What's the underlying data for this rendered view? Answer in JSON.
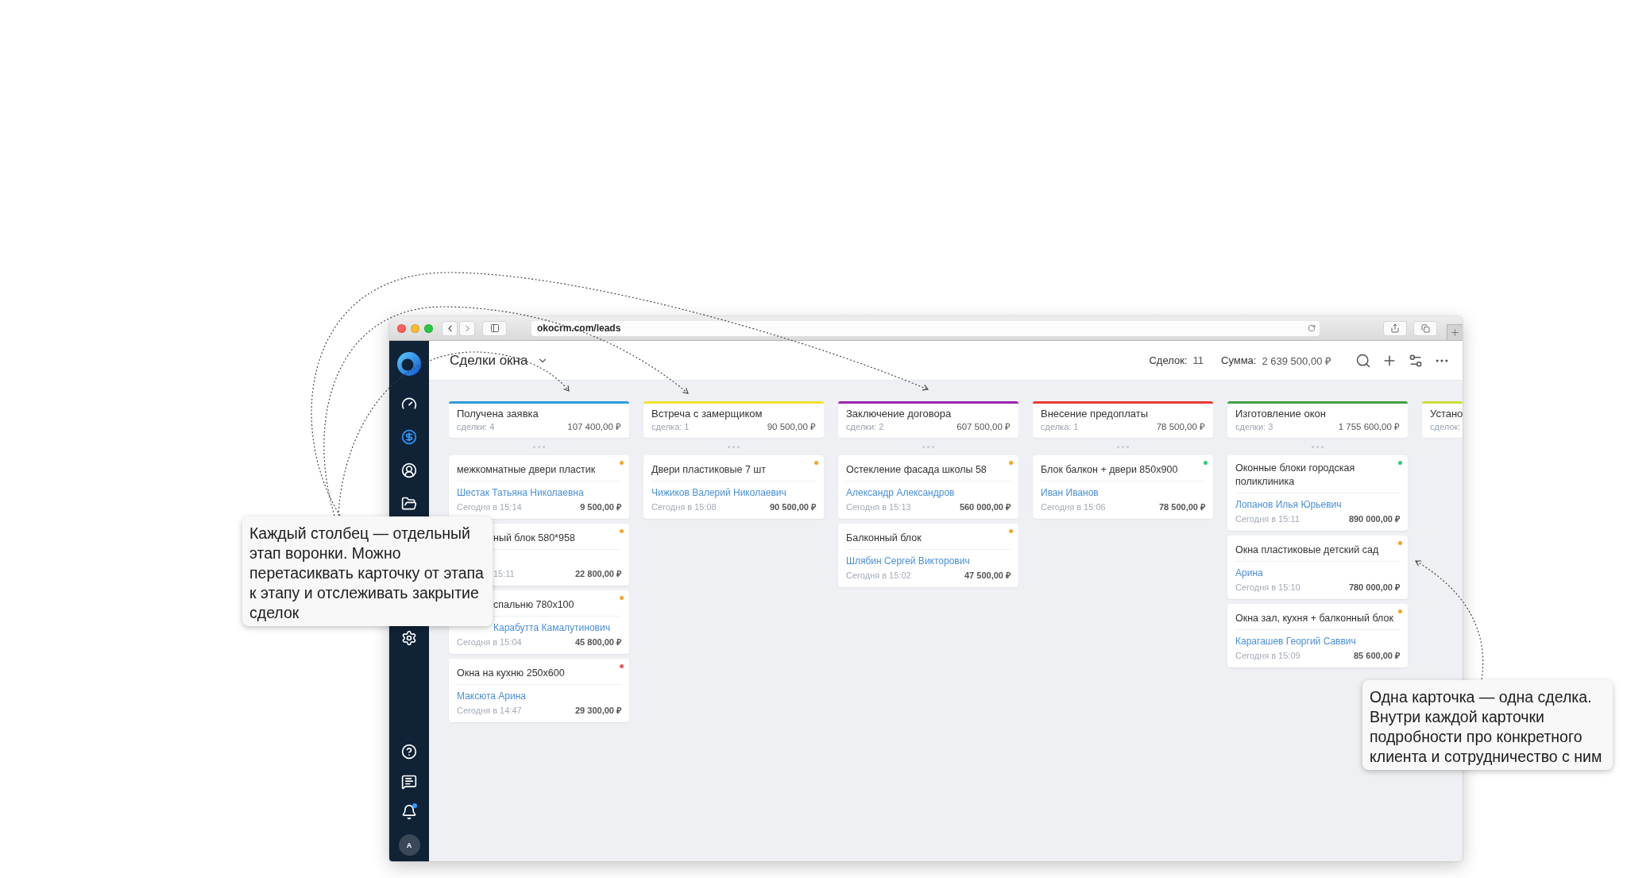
{
  "browser": {
    "url": "okocrm.com/leads"
  },
  "sidebar": {
    "top_items": [
      {
        "kind": "gauge",
        "selected": false
      },
      {
        "kind": "dollar",
        "selected": true
      },
      {
        "kind": "user",
        "selected": false
      },
      {
        "kind": "folder",
        "selected": false
      }
    ],
    "lower_items": [
      {
        "kind": "gear",
        "selected": false
      }
    ],
    "bottom_items": [
      {
        "kind": "help",
        "unread": false
      },
      {
        "kind": "chat",
        "unread": false
      },
      {
        "kind": "bell",
        "unread": true
      }
    ],
    "avatar": "A"
  },
  "header": {
    "title": "Сделки окна",
    "deals_label": "Сделок:",
    "deals_count": "11",
    "sum_label": "Сумма:",
    "sum_value": "2 639 500,00 ₽"
  },
  "board": {
    "columns": [
      {
        "title": "Получена заявка",
        "count": "сделки: 4",
        "amount": "107 400,00 ₽",
        "color": "#2d9cdb",
        "cards": [
          {
            "kind": "deal",
            "title": "межкомнатные двери пластик",
            "client": "Шестак Татьяна Николаевна",
            "date": "Сегодня в 15:14",
            "sum": "9 500,00 ₽",
            "color": "#f5a623"
          },
          {
            "kind": "covered",
            "title": "ный блок 580*958",
            "date": "15:11",
            "sum": "22 800,00 ₽",
            "color": "#f5a623"
          },
          {
            "kind": "partly_covered",
            "title": "спальню 780x100",
            "client": "Карабутта Камалутинович",
            "date": "Сегодня в 15:04",
            "sum": "45 800,00 ₽",
            "color": "#f5a623"
          },
          {
            "kind": "deal",
            "title": "Окна на кухню 250x600",
            "client": "Максюта Арина",
            "date": "Сегодня в 14:47",
            "sum": "29 300,00 ₽",
            "color": "#eb5757"
          }
        ]
      },
      {
        "title": "Встреча с замерщиком",
        "count": "сделка: 1",
        "amount": "90 500,00 ₽",
        "color": "#f2e230",
        "cards": [
          {
            "kind": "deal",
            "title": "Двери пластиковые 7 шт",
            "client": "Чижиков Валерий Николаевич",
            "date": "Сегодня в 15:08",
            "sum": "90 500,00 ₽",
            "color": "#f5a623"
          }
        ]
      },
      {
        "title": "Заключение договора",
        "count": "сделки: 2",
        "amount": "607 500,00 ₽",
        "color": "#9c27b0",
        "cards": [
          {
            "kind": "deal",
            "title": "Остекление фасада школы 58",
            "client": "Александр Александров",
            "date": "Сегодня в 15:13",
            "sum": "560 000,00 ₽",
            "color": "#f5a623"
          },
          {
            "kind": "deal",
            "title": "Балконный блок",
            "client": "Шлябин Сергей Викторович",
            "date": "Сегодня в 15:02",
            "sum": "47 500,00 ₽",
            "color": "#f5a623"
          }
        ]
      },
      {
        "title": "Внесение предоплаты",
        "count": "сделка: 1",
        "amount": "78 500,00 ₽",
        "color": "#e53935",
        "cards": [
          {
            "kind": "deal",
            "title": "Блок балкон + двери 850x900",
            "client": "Иван Иванов",
            "date": "Сегодня в 15:06",
            "sum": "78 500,00 ₽",
            "color": "#2ecc71"
          }
        ]
      },
      {
        "title": "Изготовление окон",
        "count": "сделки: 3",
        "amount": "1 755 600,00 ₽",
        "color": "#43a047",
        "cards": [
          {
            "kind": "deal",
            "title": "Оконные блоки городская поликлиника",
            "client": "Лопанов Илья Юрьевич",
            "date": "Сегодня в 15:11",
            "sum": "890 000,00 ₽",
            "color": "#2ecc71"
          },
          {
            "kind": "deal",
            "title": "Окна пластиковые детский сад",
            "client": "Арина",
            "date": "Сегодня в 15:10",
            "sum": "780 000,00 ₽",
            "color": "#f5a623"
          },
          {
            "kind": "deal",
            "title": "Окна зал, кухня + балконный блок",
            "client": "Карагашев Георгий Саввич",
            "date": "Сегодня в 15:09",
            "sum": "85 600,00 ₽",
            "color": "#f5a623"
          }
        ]
      },
      {
        "title": "Устано",
        "count": "сделок:",
        "color": "#cddc39"
      }
    ]
  },
  "callouts": {
    "columns_note": "Каждый столбец — отдельный этап воронки. Можно перетасиквать карточку от этапа к этапу и отслеживать закрытие сделок",
    "card_note": "Одна карточка — одна сделка. Внутри каждой карточки подробности про конкретного клиента и сотрудничество с ним"
  }
}
